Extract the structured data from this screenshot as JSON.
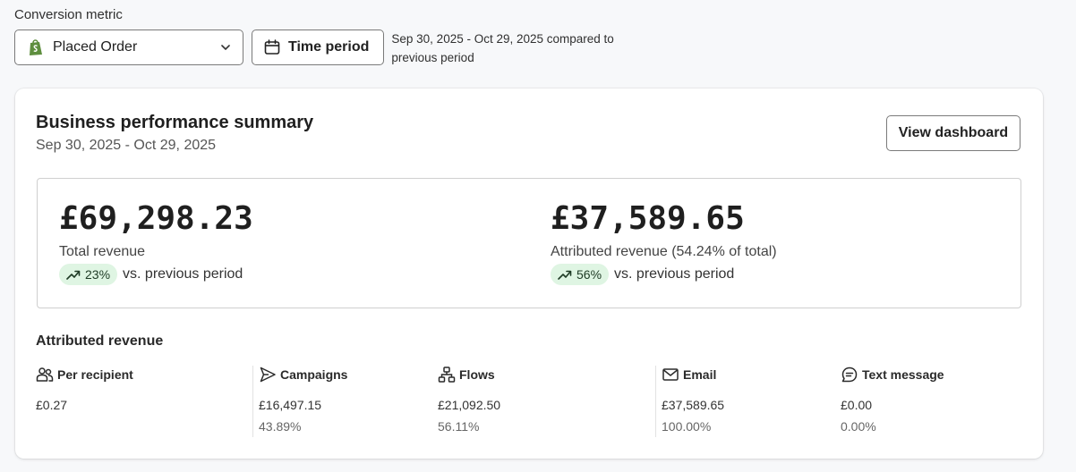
{
  "conversion": {
    "label": "Conversion metric",
    "selected": "Placed Order",
    "time_period_label": "Time period",
    "period_note": "Sep 30, 2025 - Oct 29, 2025 compared to previous period"
  },
  "card": {
    "title": "Business performance summary",
    "subtitle": "Sep 30, 2025 - Oct 29, 2025",
    "view_button": "View dashboard"
  },
  "summary": {
    "total": {
      "amount": "£69,298.23",
      "label": "Total revenue",
      "delta": "23%",
      "delta_text": "vs. previous period"
    },
    "attributed": {
      "amount": "£37,589.65",
      "label": "Attributed revenue (54.24% of total)",
      "delta": "56%",
      "delta_text": "vs. previous period"
    }
  },
  "attributed": {
    "title": "Attributed revenue",
    "stats": [
      {
        "label": "Per recipient",
        "value": "£0.27",
        "percent": "",
        "icon": "people-icon"
      },
      {
        "label": "Campaigns",
        "value": "£16,497.15",
        "percent": "43.89%",
        "icon": "send-icon"
      },
      {
        "label": "Flows",
        "value": "£21,092.50",
        "percent": "56.11%",
        "icon": "flow-icon"
      },
      {
        "label": "Email",
        "value": "£37,589.65",
        "percent": "100.00%",
        "icon": "mail-icon"
      },
      {
        "label": "Text message",
        "value": "£0.00",
        "percent": "0.00%",
        "icon": "message-icon"
      }
    ]
  },
  "colors": {
    "badge_bg": "#dff5e3",
    "shopify_green": "#5e8e3e"
  }
}
